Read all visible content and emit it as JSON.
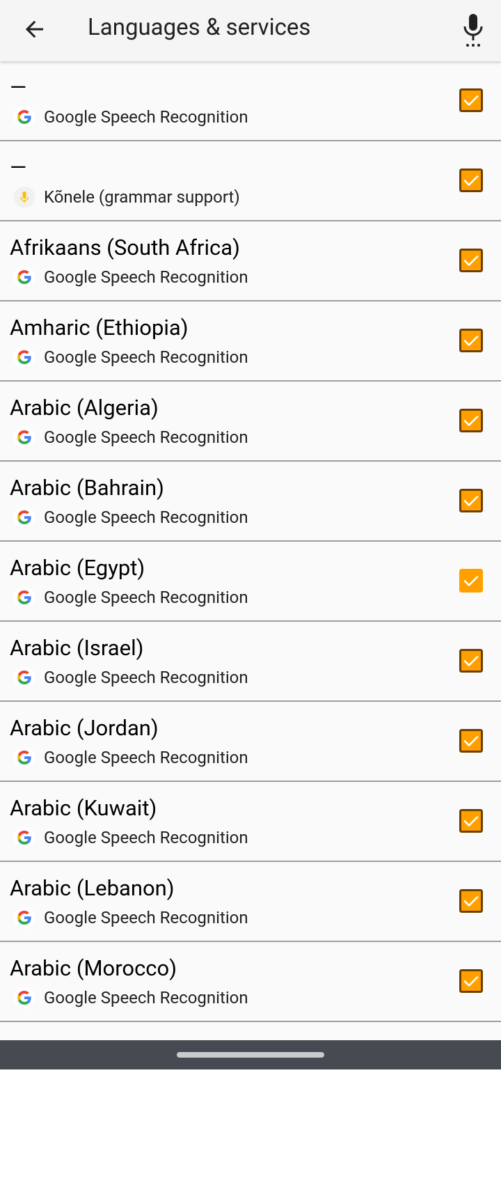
{
  "appbar": {
    "title": "Languages & services"
  },
  "items": [
    {
      "name": "—",
      "service": "Google Speech Recognition",
      "icon": "google-g-icon",
      "checked": true
    },
    {
      "name": "—",
      "service": "Kõnele (grammar support)",
      "icon": "konele-mic-icon",
      "checked": true
    },
    {
      "name": "Afrikaans (South Africa)",
      "service": "Google Speech Recognition",
      "icon": "google-g-icon",
      "checked": true
    },
    {
      "name": "Amharic (Ethiopia)",
      "service": "Google Speech Recognition",
      "icon": "google-g-icon",
      "checked": true
    },
    {
      "name": "Arabic (Algeria)",
      "service": "Google Speech Recognition",
      "icon": "google-g-icon",
      "checked": true
    },
    {
      "name": "Arabic (Bahrain)",
      "service": "Google Speech Recognition",
      "icon": "google-g-icon",
      "checked": true
    },
    {
      "name": "Arabic (Egypt)",
      "service": "Google Speech Recognition",
      "icon": "google-g-icon",
      "checked": true
    },
    {
      "name": "Arabic (Israel)",
      "service": "Google Speech Recognition",
      "icon": "google-g-icon",
      "checked": true
    },
    {
      "name": "Arabic (Jordan)",
      "service": "Google Speech Recognition",
      "icon": "google-g-icon",
      "checked": true
    },
    {
      "name": "Arabic (Kuwait)",
      "service": "Google Speech Recognition",
      "icon": "google-g-icon",
      "checked": true
    },
    {
      "name": "Arabic (Lebanon)",
      "service": "Google Speech Recognition",
      "icon": "google-g-icon",
      "checked": true
    },
    {
      "name": "Arabic (Morocco)",
      "service": "Google Speech Recognition",
      "icon": "google-g-icon",
      "checked": true
    },
    {
      "name": "—",
      "service": "",
      "icon": "",
      "checked": true
    }
  ],
  "colors": {
    "checkbox_fill": "#ffa000",
    "checkbox_border": "#6d4000",
    "divider": "#9e9e9e",
    "navbar": "#454b50"
  }
}
